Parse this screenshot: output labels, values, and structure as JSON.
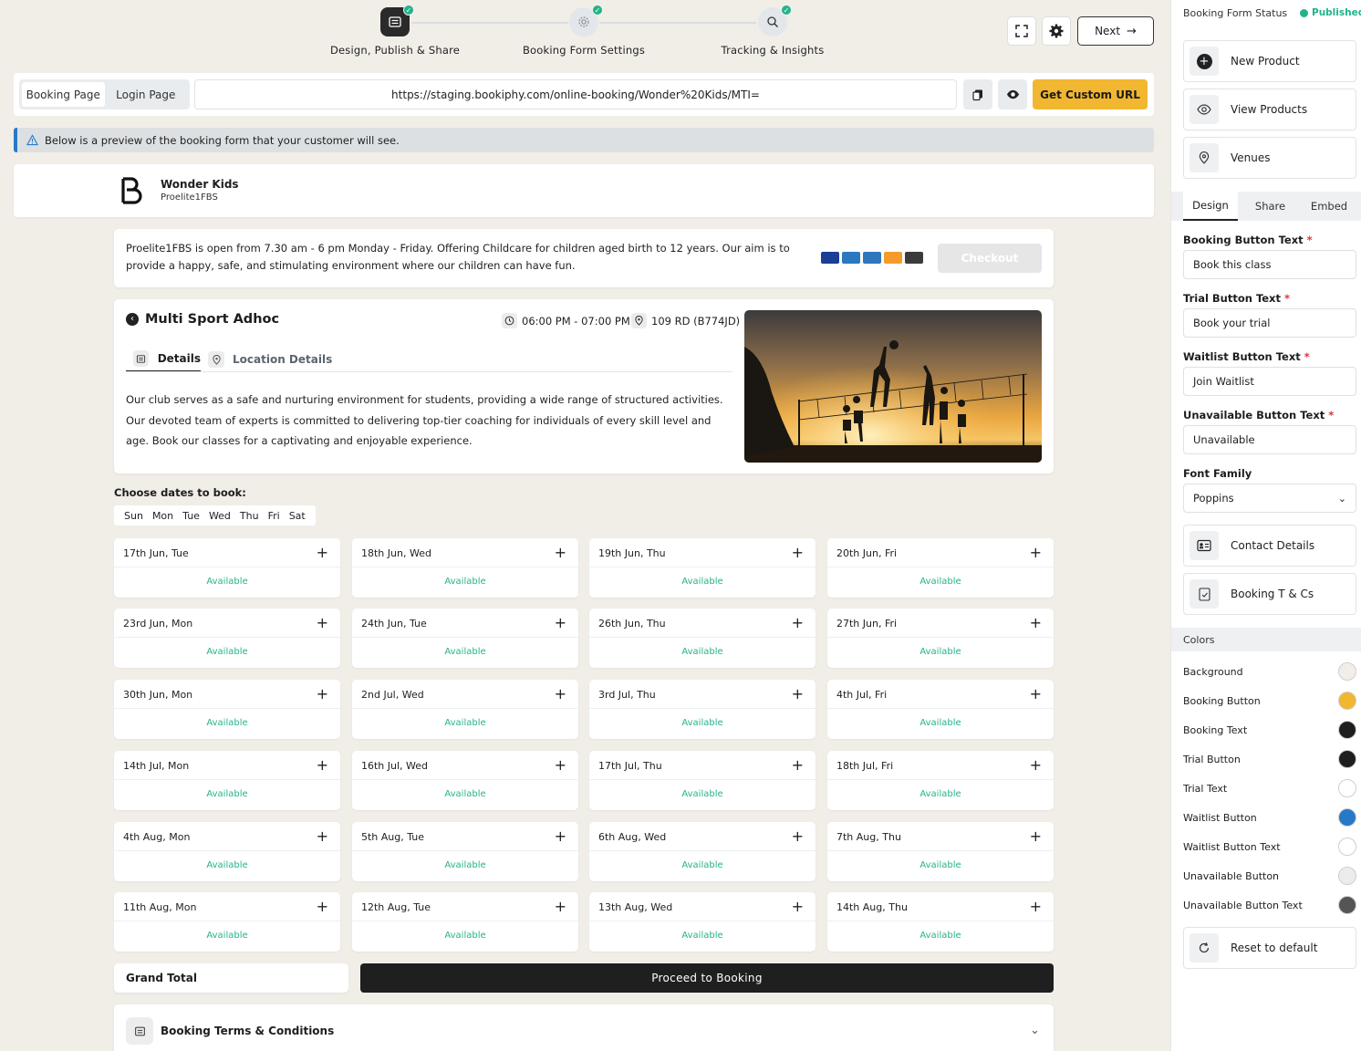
{
  "stepper": {
    "steps": [
      {
        "label": "Design, Publish & Share",
        "icon": "form-icon"
      },
      {
        "label": "Booking Form Settings",
        "icon": "gear-icon"
      },
      {
        "label": "Tracking & Insights",
        "icon": "insights-icon"
      }
    ]
  },
  "toolbar": {
    "next_label": "Next"
  },
  "url_bar": {
    "tabs": [
      "Booking Page",
      "Login Page"
    ],
    "url": "https://staging.bookiphy.com/online-booking/Wonder%20Kids/MTI=",
    "custom_url_label": "Get Custom URL"
  },
  "notice": "Below is a preview of the booking form that your customer will see.",
  "brand": {
    "name": "Wonder Kids",
    "sub": "Proelite1FBS"
  },
  "intro": {
    "text": "Proelite1FBS is open from 7.30 am - 6 pm Monday - Friday. Offering Childcare for children aged birth to 12 years. Our aim is to provide a happy, safe, and stimulating environment where our children can have fun.",
    "checkout_label": "Checkout"
  },
  "class": {
    "title": "Multi Sport Adhoc",
    "time": "06:00 PM - 07:00 PM",
    "location": "109 RD (B774JD)",
    "tabs": [
      "Details",
      "Location Details"
    ],
    "description": "Our club serves as a safe and nurturing environment for students, providing a wide range of structured activities. Our devoted team of experts is committed to delivering top-tier coaching for individuals of every skill level and age. Book our classes for a captivating and enjoyable experience."
  },
  "dates": {
    "heading": "Choose dates to book:",
    "weekdays": [
      "Sun",
      "Mon",
      "Tue",
      "Wed",
      "Thu",
      "Fri",
      "Sat"
    ],
    "status": "Available",
    "items": [
      "17th Jun, Tue",
      "18th Jun, Wed",
      "19th Jun, Thu",
      "20th Jun, Fri",
      "23rd Jun, Mon",
      "24th Jun, Tue",
      "26th Jun, Thu",
      "27th Jun, Fri",
      "30th Jun, Mon",
      "2nd Jul, Wed",
      "3rd Jul, Thu",
      "4th Jul, Fri",
      "14th Jul, Mon",
      "16th Jul, Wed",
      "17th Jul, Thu",
      "18th Jul, Fri",
      "4th Aug, Mon",
      "5th Aug, Tue",
      "6th Aug, Wed",
      "7th Aug, Thu",
      "11th Aug, Mon",
      "12th Aug, Tue",
      "13th Aug, Wed",
      "14th Aug, Thu"
    ]
  },
  "footer": {
    "grand_total": "Grand Total",
    "proceed": "Proceed to Booking",
    "terms": "Booking Terms & Conditions"
  },
  "sidebar": {
    "status_label": "Booking Form Status",
    "status_value": "Published",
    "links": [
      "New Product",
      "View Products",
      "Venues"
    ],
    "tabs": [
      "Design",
      "Share",
      "Embed"
    ],
    "fields": [
      {
        "label": "Booking Button Text",
        "value": "Book this class"
      },
      {
        "label": "Trial Button Text",
        "value": "Book your trial"
      },
      {
        "label": "Waitlist Button Text",
        "value": "Join Waitlist"
      },
      {
        "label": "Unavailable Button Text",
        "value": "Unavailable"
      }
    ],
    "font_label": "Font Family",
    "font_value": "Poppins",
    "extra_links": [
      "Contact Details",
      "Booking T & Cs"
    ],
    "colors_heading": "Colors",
    "colors": [
      {
        "label": "Background",
        "color": "#f1eee8"
      },
      {
        "label": "Booking Button",
        "color": "#f1b730"
      },
      {
        "label": "Booking Text",
        "color": "#1e1e1e"
      },
      {
        "label": "Trial Button",
        "color": "#1e1e1e"
      },
      {
        "label": "Trial Text",
        "color": "#ffffff"
      },
      {
        "label": "Waitlist Button",
        "color": "#2779c8"
      },
      {
        "label": "Waitlist Button Text",
        "color": "#ffffff"
      },
      {
        "label": "Unavailable Button",
        "color": "#ececec"
      },
      {
        "label": "Unavailable Button Text",
        "color": "#555555"
      }
    ],
    "reset_label": "Reset to default"
  }
}
